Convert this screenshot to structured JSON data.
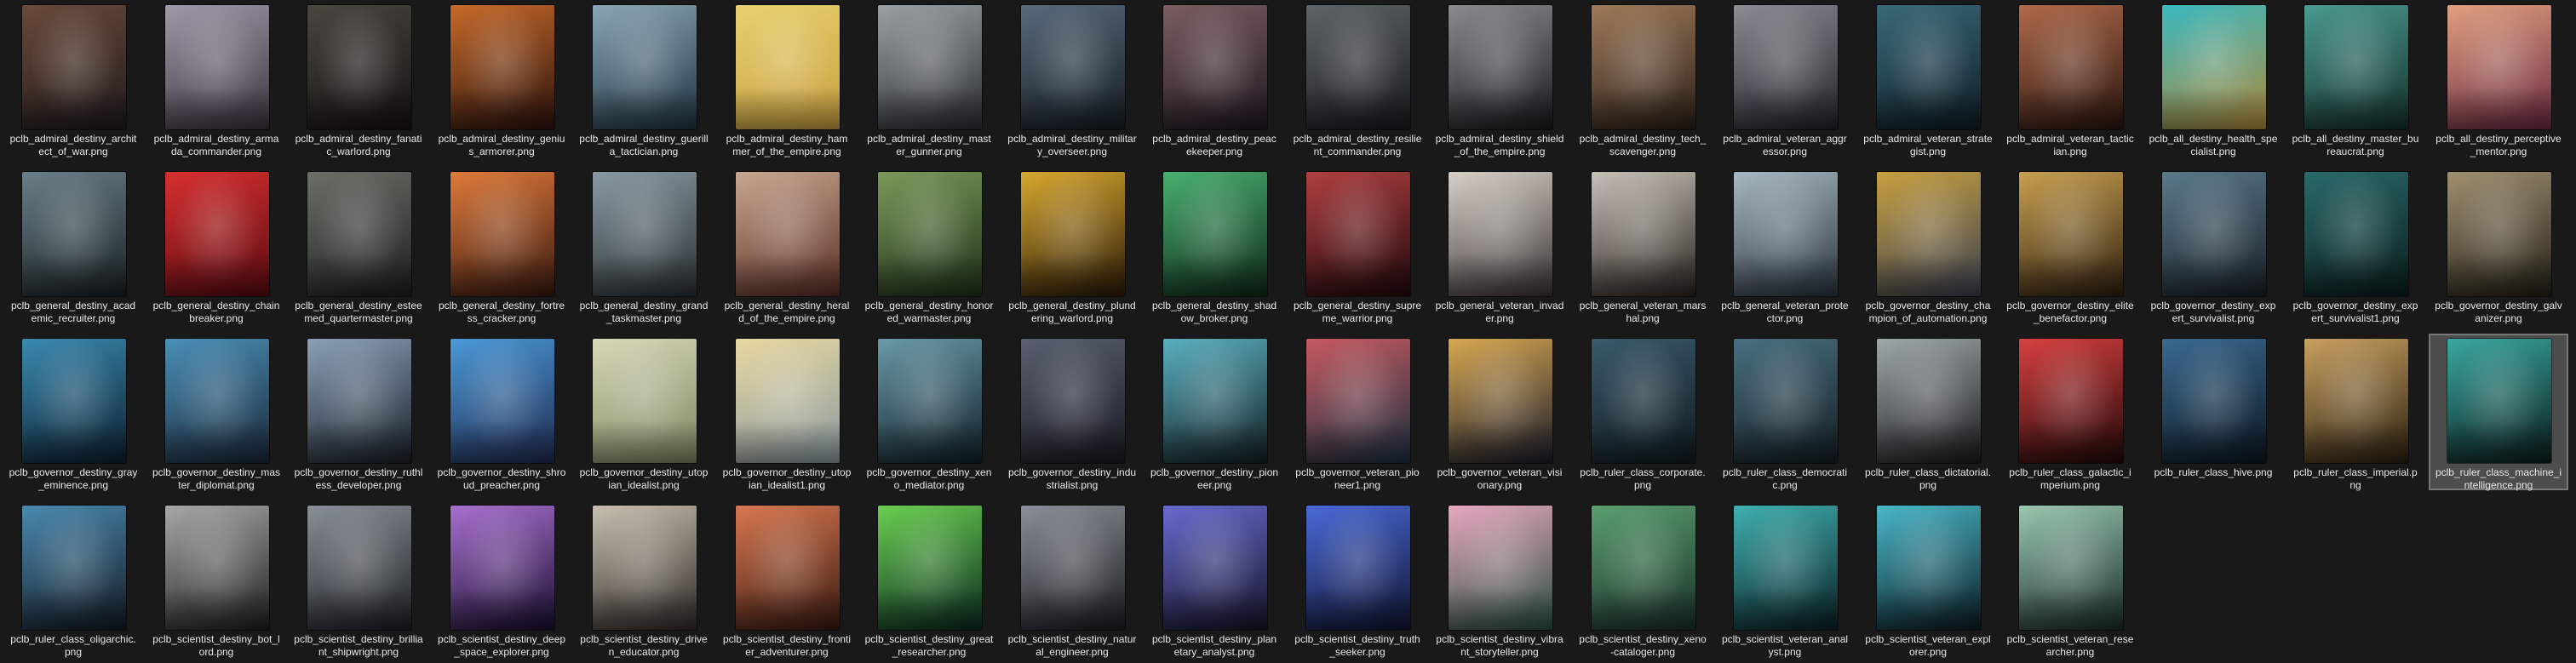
{
  "window": {
    "view": "large-icons",
    "selected_item": "pclb_ruler_class_machine_intelligence.png"
  },
  "files": [
    {
      "name": "pclb_admiral_destiny_architect_of_war.png",
      "colors": [
        "#6b4a3a",
        "#1f1a1c"
      ]
    },
    {
      "name": "pclb_admiral_destiny_armada_commander.png",
      "colors": [
        "#a09aa8",
        "#3a3440"
      ]
    },
    {
      "name": "pclb_admiral_destiny_fanatic_warlord.png",
      "colors": [
        "#4a4640",
        "#141210"
      ]
    },
    {
      "name": "pclb_admiral_destiny_genius_armorer.png",
      "colors": [
        "#c86a2a",
        "#2a120c"
      ]
    },
    {
      "name": "pclb_admiral_destiny_guerilla_tactician.png",
      "colors": [
        "#8aa6b4",
        "#1e3440"
      ]
    },
    {
      "name": "pclb_admiral_destiny_hammer_of_the_empire.png",
      "colors": [
        "#e8d070",
        "#c8a040"
      ]
    },
    {
      "name": "pclb_admiral_destiny_master_gunner.png",
      "colors": [
        "#9aa0a4",
        "#2a2e30"
      ]
    },
    {
      "name": "pclb_admiral_destiny_military_overseer.png",
      "colors": [
        "#5a6a7a",
        "#141c24"
      ]
    },
    {
      "name": "pclb_admiral_destiny_peacekeeper.png",
      "colors": [
        "#7a5e60",
        "#201820"
      ]
    },
    {
      "name": "pclb_admiral_destiny_resilient_commander.png",
      "colors": [
        "#5e6468",
        "#181a1c"
      ]
    },
    {
      "name": "pclb_admiral_destiny_shield_of_the_empire.png",
      "colors": [
        "#8a8c90",
        "#1a1a1c"
      ]
    },
    {
      "name": "pclb_admiral_destiny_tech_scavenger.png",
      "colors": [
        "#a07a5a",
        "#2a2018"
      ]
    },
    {
      "name": "pclb_admiral_veteran_aggressor.png",
      "colors": [
        "#8a8e94",
        "#20242a"
      ]
    },
    {
      "name": "pclb_admiral_veteran_strategist.png",
      "colors": [
        "#3a6a7a",
        "#0e1c24"
      ]
    },
    {
      "name": "pclb_admiral_veteran_tactician.png",
      "colors": [
        "#b06a4a",
        "#2a1610"
      ]
    },
    {
      "name": "pclb_all_destiny_health_specialist.png",
      "colors": [
        "#3ab8c0",
        "#b08a3a"
      ]
    },
    {
      "name": "pclb_all_destiny_master_bureaucrat.png",
      "colors": [
        "#4a9a90",
        "#14302c"
      ]
    },
    {
      "name": "pclb_all_destiny_perceptive_mentor.png",
      "colors": [
        "#e0a080",
        "#6a2a40"
      ]
    },
    {
      "name": "pclb_general_destiny_academic_recruiter.png",
      "colors": [
        "#6a8088",
        "#1a2024"
      ]
    },
    {
      "name": "pclb_general_destiny_chainbreaker.png",
      "colors": [
        "#d83030",
        "#5a0a10"
      ]
    },
    {
      "name": "pclb_general_destiny_esteemed_quartermaster.png",
      "colors": [
        "#6a7068",
        "#1c201c"
      ]
    },
    {
      "name": "pclb_general_destiny_fortress_cracker.png",
      "colors": [
        "#e07a3a",
        "#3a1a10"
      ]
    },
    {
      "name": "pclb_general_destiny_grand_taskmaster.png",
      "colors": [
        "#8a9aa2",
        "#2a3034"
      ]
    },
    {
      "name": "pclb_general_destiny_herald_of_the_empire.png",
      "colors": [
        "#c8a890",
        "#5a2e24"
      ]
    },
    {
      "name": "pclb_general_destiny_honored_warmaster.png",
      "colors": [
        "#7a9a5a",
        "#203018"
      ]
    },
    {
      "name": "pclb_general_destiny_plundering_warlord.png",
      "colors": [
        "#d8a830",
        "#2a1a08"
      ]
    },
    {
      "name": "pclb_general_destiny_shadow_broker.png",
      "colors": [
        "#4ab070",
        "#0e2a1a"
      ]
    },
    {
      "name": "pclb_general_destiny_supreme_warrior.png",
      "colors": [
        "#b04040",
        "#20080c"
      ]
    },
    {
      "name": "pclb_general_veteran_invader.png",
      "colors": [
        "#d8d0c8",
        "#3a3434"
      ]
    },
    {
      "name": "pclb_general_veteran_marshal.png",
      "colors": [
        "#c8c0b8",
        "#2a2420"
      ]
    },
    {
      "name": "pclb_general_veteran_protector.png",
      "colors": [
        "#a8b8c0",
        "#2a3440"
      ]
    },
    {
      "name": "pclb_governor_destiny_champion_of_automation.png",
      "colors": [
        "#c8a040",
        "#3a4050"
      ]
    },
    {
      "name": "pclb_governor_destiny_elite_benefactor.png",
      "colors": [
        "#c8a050",
        "#302010"
      ]
    },
    {
      "name": "pclb_governor_destiny_expert_survivalist.png",
      "colors": [
        "#5a7a8a",
        "#1a2028"
      ]
    },
    {
      "name": "pclb_governor_destiny_expert_survivalist1.png",
      "colors": [
        "#2a6a6a",
        "#0a1c1c"
      ]
    },
    {
      "name": "pclb_governor_destiny_galvanizer.png",
      "colors": [
        "#a09070",
        "#242018"
      ]
    },
    {
      "name": "pclb_governor_destiny_gray_eminence.png",
      "colors": [
        "#3a8ab0",
        "#0c2030"
      ]
    },
    {
      "name": "pclb_governor_destiny_master_diplomat.png",
      "colors": [
        "#4a90b8",
        "#1a2838"
      ]
    },
    {
      "name": "pclb_governor_destiny_ruthless_developer.png",
      "colors": [
        "#8aa0b8",
        "#1a2028"
      ]
    },
    {
      "name": "pclb_governor_destiny_shroud_preacher.png",
      "colors": [
        "#4a9ad8",
        "#202a50"
      ]
    },
    {
      "name": "pclb_governor_destiny_utopian_idealist.png",
      "colors": [
        "#d8d8b8",
        "#7a8860"
      ]
    },
    {
      "name": "pclb_governor_destiny_utopian_idealist1.png",
      "colors": [
        "#e8d8a0",
        "#8a9aa0"
      ]
    },
    {
      "name": "pclb_governor_destiny_xeno_mediator.png",
      "colors": [
        "#6a9aa8",
        "#102028"
      ]
    },
    {
      "name": "pclb_governor_destiny_industrialist.png",
      "colors": [
        "#5a6070",
        "#181a22"
      ]
    },
    {
      "name": "pclb_governor_destiny_pioneer.png",
      "colors": [
        "#5ab0c0",
        "#142024"
      ]
    },
    {
      "name": "pclb_governor_veteran_pioneer1.png",
      "colors": [
        "#c85a60",
        "#1a3040"
      ]
    },
    {
      "name": "pclb_governor_veteran_visionary.png",
      "colors": [
        "#d8a850",
        "#1a1c2a"
      ]
    },
    {
      "name": "pclb_ruler_class_corporate.png",
      "colors": [
        "#3a5a6a",
        "#101a20"
      ]
    },
    {
      "name": "pclb_ruler_class_democratic.png",
      "colors": [
        "#4a7080",
        "#141e24"
      ]
    },
    {
      "name": "pclb_ruler_class_dictatorial.png",
      "colors": [
        "#a0a8a8",
        "#1a1c1c"
      ]
    },
    {
      "name": "pclb_ruler_class_galactic_imperium.png",
      "colors": [
        "#d84040",
        "#200808"
      ]
    },
    {
      "name": "pclb_ruler_class_hive.png",
      "colors": [
        "#3a6a90",
        "#0c1620"
      ]
    },
    {
      "name": "pclb_ruler_class_imperial.png",
      "colors": [
        "#c8a060",
        "#2a2010"
      ]
    },
    {
      "name": "pclb_ruler_class_machine_intelligence.png",
      "colors": [
        "#3aa8a0",
        "#0a1c1c"
      ]
    },
    {
      "name": "pclb_ruler_class_oligarchic.png",
      "colors": [
        "#4a8ab0",
        "#141a24"
      ]
    },
    {
      "name": "pclb_scientist_destiny_bot_lord.png",
      "colors": [
        "#a8a8a8",
        "#202020"
      ]
    },
    {
      "name": "pclb_scientist_destiny_brilliant_shipwright.png",
      "colors": [
        "#8a9098",
        "#1c2024"
      ]
    },
    {
      "name": "pclb_scientist_destiny_deep_space_explorer.png",
      "colors": [
        "#a870d0",
        "#1a1030"
      ]
    },
    {
      "name": "pclb_scientist_destiny_driven_educator.png",
      "colors": [
        "#c8c0b0",
        "#302a28"
      ]
    },
    {
      "name": "pclb_scientist_destiny_frontier_adventurer.png",
      "colors": [
        "#d87850",
        "#3a1a10"
      ]
    },
    {
      "name": "pclb_scientist_destiny_great_researcher.png",
      "colors": [
        "#6ad050",
        "#0a2a20"
      ]
    },
    {
      "name": "pclb_scientist_destiny_natural_engineer.png",
      "colors": [
        "#8a9098",
        "#1a1c20"
      ]
    },
    {
      "name": "pclb_scientist_destiny_planetary_analyst.png",
      "colors": [
        "#6a6ad0",
        "#141428"
      ]
    },
    {
      "name": "pclb_scientist_destiny_truth_seeker.png",
      "colors": [
        "#4a6ad8",
        "#101430"
      ]
    },
    {
      "name": "pclb_scientist_destiny_vibrant_storyteller.png",
      "colors": [
        "#e8a8c0",
        "#2a5040"
      ]
    },
    {
      "name": "pclb_scientist_destiny_xeno-cataloger.png",
      "colors": [
        "#5aa070",
        "#1a3028"
      ]
    },
    {
      "name": "pclb_scientist_veteran_analyst.png",
      "colors": [
        "#40b0b0",
        "#0a2024"
      ]
    },
    {
      "name": "pclb_scientist_veteran_explorer.png",
      "colors": [
        "#4ab8c8",
        "#0c1c24"
      ]
    },
    {
      "name": "pclb_scientist_veteran_researcher.png",
      "colors": [
        "#9ac8b0",
        "#1a2c28"
      ]
    }
  ]
}
